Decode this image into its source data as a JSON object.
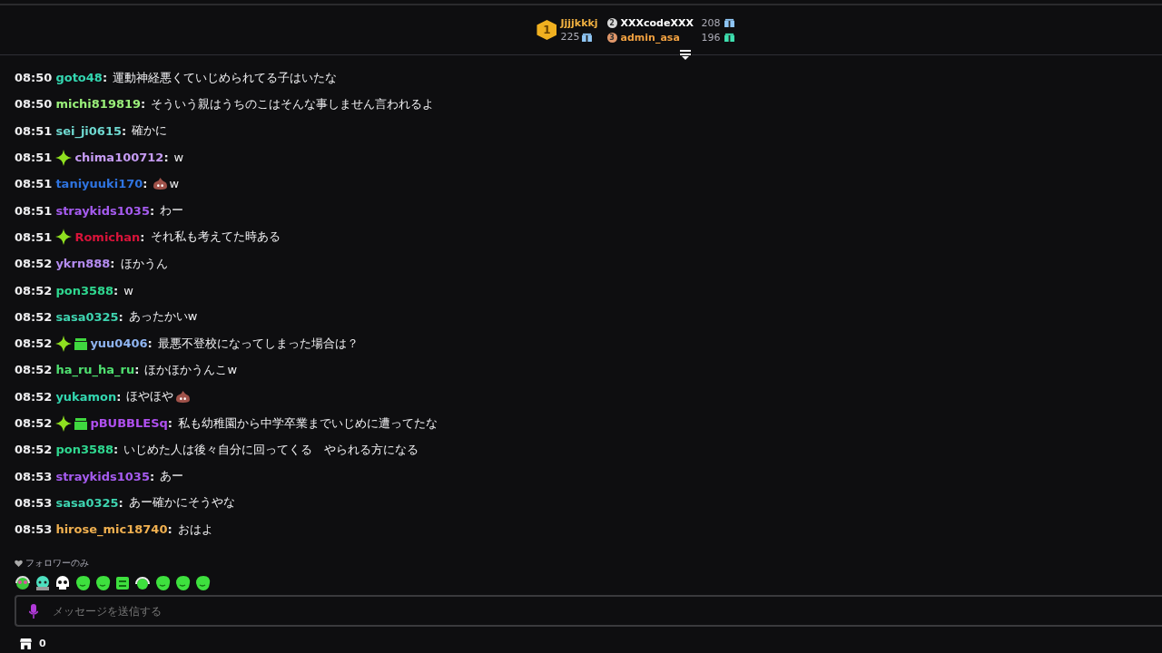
{
  "leaderboard": {
    "first": {
      "rank": "1",
      "name": "Jjjjkkkj",
      "count": "225"
    },
    "others": [
      {
        "rank": "2",
        "name": "XXXcodeXXX",
        "count": "208"
      },
      {
        "rank": "3",
        "name": "admin_asa",
        "count": "196"
      }
    ]
  },
  "messages": [
    {
      "time": "08:50",
      "user": "goto48",
      "separator": ":",
      "color": "#33d6b0",
      "parts": [
        {
          "kind": "text",
          "text": "運動神経悪くていじめられてる子はいたな"
        }
      ]
    },
    {
      "time": "08:50",
      "user": "michi819819",
      "separator": ":",
      "color": "#9af07a",
      "parts": [
        {
          "kind": "text",
          "text": "そういう親はうちのこはそんな事しません言われるよ"
        }
      ]
    },
    {
      "time": "08:51",
      "user": "sei_ji0615",
      "separator": ":",
      "color": "#6fd8d0",
      "parts": [
        {
          "kind": "text",
          "text": "確かに"
        }
      ]
    },
    {
      "time": "08:51",
      "badges": [
        {
          "kind": "sparkle"
        }
      ],
      "user": "chima100712",
      "separator": ":",
      "color": "#c69cf5",
      "parts": [
        {
          "kind": "text",
          "text": "w"
        }
      ]
    },
    {
      "time": "08:51",
      "user": "taniyuuki170",
      "separator": ":",
      "color": "#2f74e0",
      "parts": [
        {
          "kind": "emote"
        },
        {
          "kind": "text",
          "text": "w"
        }
      ]
    },
    {
      "time": "08:51",
      "user": "straykids1035",
      "separator": ":",
      "color": "#a65cf0",
      "parts": [
        {
          "kind": "text",
          "text": "わー"
        }
      ]
    },
    {
      "time": "08:51",
      "badges": [
        {
          "kind": "sparkle"
        }
      ],
      "user": "Romichan",
      "separator": ":",
      "color": "#d8143a",
      "parts": [
        {
          "kind": "text",
          "text": "それ私も考えてた時ある"
        }
      ]
    },
    {
      "time": "08:52",
      "user": "ykrn888",
      "separator": ":",
      "color": "#b48cf0",
      "parts": [
        {
          "kind": "text",
          "text": "ほかうん"
        }
      ]
    },
    {
      "time": "08:52",
      "user": "pon3588",
      "separator": ":",
      "color": "#2fd890",
      "parts": [
        {
          "kind": "text",
          "text": "w"
        }
      ]
    },
    {
      "time": "08:52",
      "user": "sasa0325",
      "separator": ":",
      "color": "#3ed4b0",
      "parts": [
        {
          "kind": "text",
          "text": "あったかいw"
        }
      ]
    },
    {
      "time": "08:52",
      "badges": [
        {
          "kind": "sparkle"
        },
        {
          "kind": "gift"
        }
      ],
      "user": "yuu0406",
      "separator": ":",
      "color": "#8fb4f0",
      "parts": [
        {
          "kind": "text",
          "text": "最悪不登校になってしまった場合は？"
        }
      ]
    },
    {
      "time": "08:52",
      "user": "ha_ru_ha_ru",
      "separator": ":",
      "color": "#4fe070",
      "parts": [
        {
          "kind": "text",
          "text": "ほかほかうんこw"
        }
      ]
    },
    {
      "time": "08:52",
      "user": "yukamon",
      "separator": ":",
      "color": "#33d6b0",
      "parts": [
        {
          "kind": "text",
          "text": "ほやほや"
        },
        {
          "kind": "emote"
        }
      ]
    },
    {
      "time": "08:52",
      "badges": [
        {
          "kind": "sparkle"
        },
        {
          "kind": "gift"
        }
      ],
      "user": "pBUBBLESq",
      "separator": ":",
      "color": "#b050f0",
      "parts": [
        {
          "kind": "text",
          "text": "私も幼稚園から中学卒業までいじめに遭ってたな"
        }
      ]
    },
    {
      "time": "08:52",
      "user": "pon3588",
      "separator": ":",
      "color": "#2fd890",
      "parts": [
        {
          "kind": "text",
          "text": "いじめた人は後々自分に回ってくる　やられる方になる"
        }
      ]
    },
    {
      "time": "08:53",
      "user": "straykids1035",
      "separator": ":",
      "color": "#a65cf0",
      "parts": [
        {
          "kind": "text",
          "text": "あー"
        }
      ]
    },
    {
      "time": "08:53",
      "user": "sasa0325",
      "separator": ":",
      "color": "#3ed4b0",
      "parts": [
        {
          "kind": "text",
          "text": "あー確かにそうやな"
        }
      ]
    },
    {
      "time": "08:53",
      "user": "hirose_mic18740",
      "separator": ":",
      "color": "#f0b050",
      "parts": [
        {
          "kind": "text",
          "text": "おはよ"
        }
      ]
    }
  ],
  "chat_mode": "フォロワーのみ",
  "emotes": [
    {
      "kind": "headset-pink"
    },
    {
      "kind": "headset-teal"
    },
    {
      "kind": "skull"
    },
    {
      "kind": "blob"
    },
    {
      "kind": "blob"
    },
    {
      "kind": "square"
    },
    {
      "kind": "headset-green"
    },
    {
      "kind": "blob"
    },
    {
      "kind": "blob"
    },
    {
      "kind": "blob"
    }
  ],
  "input": {
    "placeholder": "メッセージを送信する"
  },
  "points": "0"
}
